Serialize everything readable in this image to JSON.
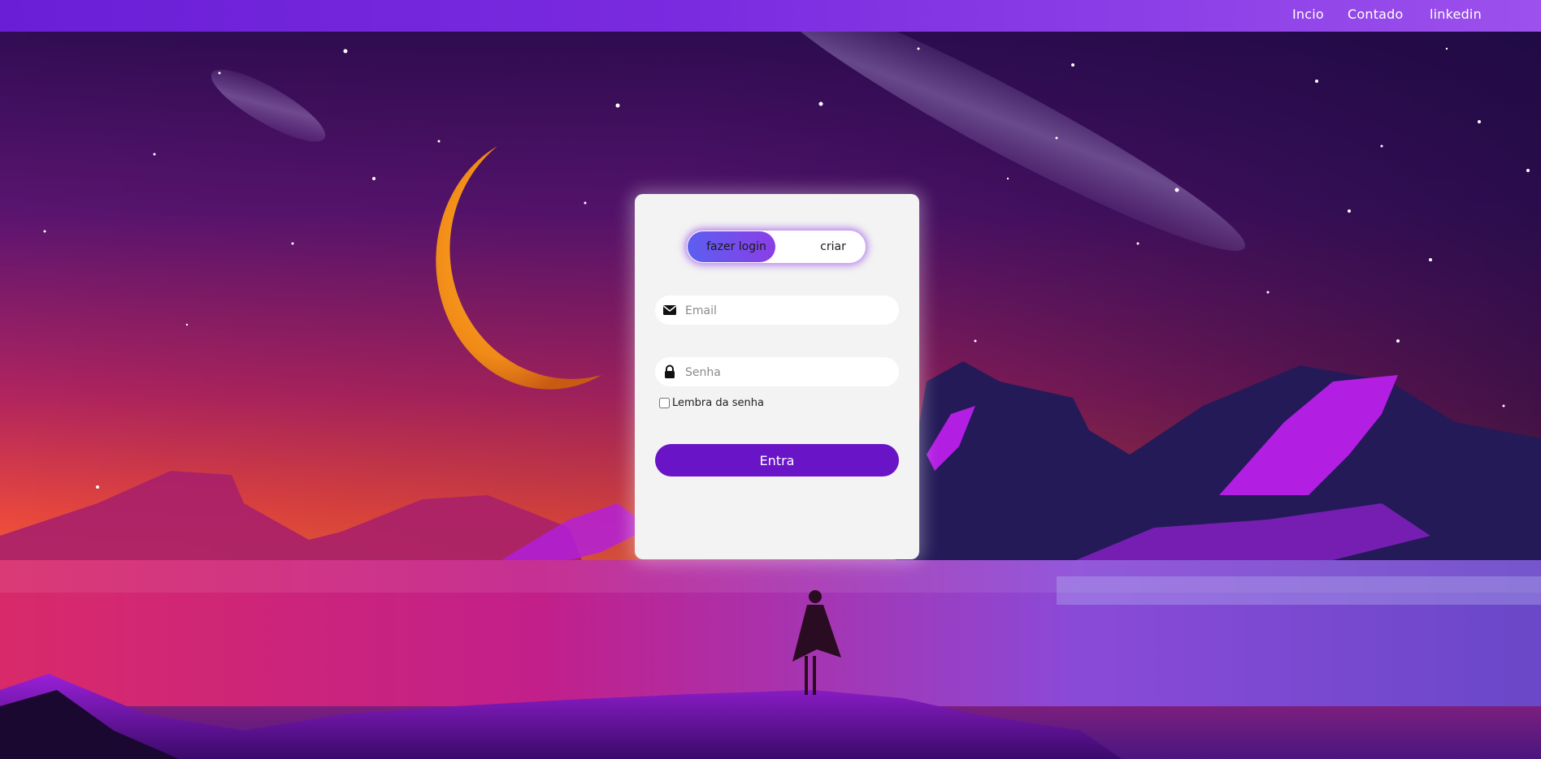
{
  "nav": {
    "links": [
      "Incio",
      "Contado",
      "linkedin"
    ]
  },
  "auth": {
    "tabs": {
      "login": "fazer login",
      "create": "criar"
    },
    "email": {
      "placeholder": "Email",
      "value": ""
    },
    "password": {
      "placeholder": "Senha",
      "value": ""
    },
    "remember_label": "Lembra da senha",
    "submit_label": "Entra"
  },
  "icons": {
    "email": "envelope-icon",
    "password": "lock-icon"
  },
  "colors": {
    "nav_start": "#6a1fd6",
    "nav_end": "#9c50ec",
    "toggle_active_start": "#5b5ff0",
    "toggle_active_end": "#8b3ee6",
    "submit_bg": "#6a14c8",
    "card_bg": "#f3f3f3"
  }
}
